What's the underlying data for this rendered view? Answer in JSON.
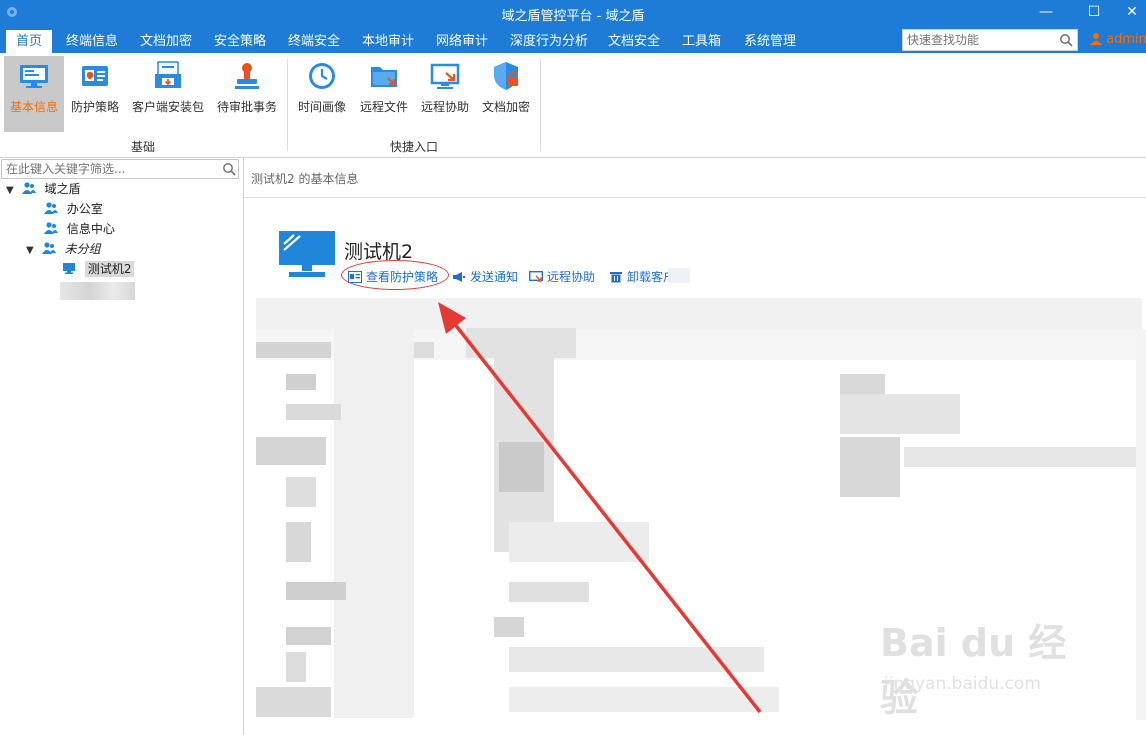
{
  "window": {
    "title": "域之盾管控平台 - 域之盾",
    "min_glyph": "—",
    "max_glyph": "☐",
    "close_glyph": "✕"
  },
  "menu": {
    "items": [
      "首页",
      "终端信息",
      "文档加密",
      "安全策略",
      "终端安全",
      "本地审计",
      "网络审计",
      "深度行为分析",
      "文档安全",
      "工具箱",
      "系统管理"
    ],
    "active_index": 0,
    "search_placeholder": "快速查找功能",
    "user": "admin"
  },
  "ribbon": {
    "groups": [
      {
        "label": "基础",
        "buttons": [
          {
            "label": "基本信息",
            "icon": "monitor-info-icon"
          },
          {
            "label": "防护策略",
            "icon": "id-card-icon"
          },
          {
            "label": "客户端安装包",
            "icon": "install-package-icon"
          },
          {
            "label": "待审批事务",
            "icon": "approval-stamp-icon"
          }
        ]
      },
      {
        "label": "快捷入口",
        "buttons": [
          {
            "label": "时间画像",
            "icon": "clock-icon"
          },
          {
            "label": "远程文件",
            "icon": "remote-folder-icon"
          },
          {
            "label": "远程协助",
            "icon": "remote-screen-icon"
          },
          {
            "label": "文档加密",
            "icon": "shield-lock-icon"
          }
        ]
      }
    ],
    "active_button": "基本信息"
  },
  "tree": {
    "filter_placeholder": "在此键入关键字筛选...",
    "nodes": [
      {
        "label": "域之盾",
        "level": 0,
        "expanded": true
      },
      {
        "label": "办公室",
        "level": 1
      },
      {
        "label": "信息中心",
        "level": 1
      },
      {
        "label": "未分组",
        "level": 1,
        "expanded": true,
        "italic": true
      },
      {
        "label": "测试机2",
        "level": 2,
        "selected": true
      }
    ]
  },
  "main": {
    "breadcrumb": "测试机2 的基本信息",
    "host_name": "测试机2",
    "actions": [
      "查看防护策略",
      "发送通知",
      "远程协助",
      "卸载客户端"
    ]
  },
  "colors": {
    "brand": "#1e7bd6",
    "accent_orange": "#ff6a00",
    "link_blue": "#1e6fcf",
    "annotation_red": "#e03c3c"
  },
  "watermark": {
    "main": "Bai du 经验",
    "sub": "jingyan.baidu.com"
  }
}
